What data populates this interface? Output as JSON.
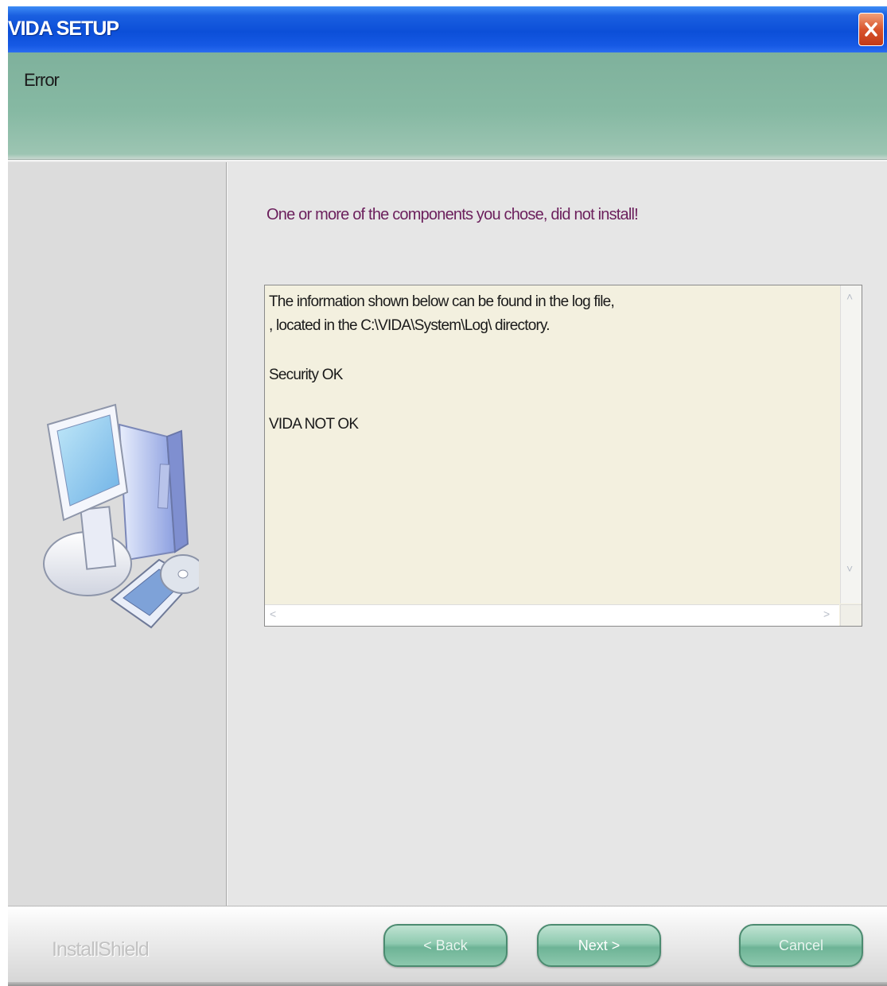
{
  "window": {
    "title": "VIDA SETUP"
  },
  "header": {
    "title": "Error"
  },
  "main": {
    "message": "One or more of the components you chose, did not install!",
    "log_lines": [
      "The information shown below can be found in the log file,",
      ", located in the C:\\VIDA\\System\\Log\\ directory.",
      "",
      "Security OK",
      "",
      "VIDA NOT OK"
    ]
  },
  "footer": {
    "brand": "InstallShield",
    "back_label": "< Back",
    "next_label": "Next >",
    "cancel_label": "Cancel"
  },
  "colors": {
    "titlebar": "#0c4fd8",
    "banner": "#86b9a3",
    "message_text": "#6b1f5c",
    "log_background": "#f3f0df",
    "button": "#7fbea3"
  },
  "icons": {
    "close": "close-icon",
    "setup_art": "computer-install-icon"
  }
}
